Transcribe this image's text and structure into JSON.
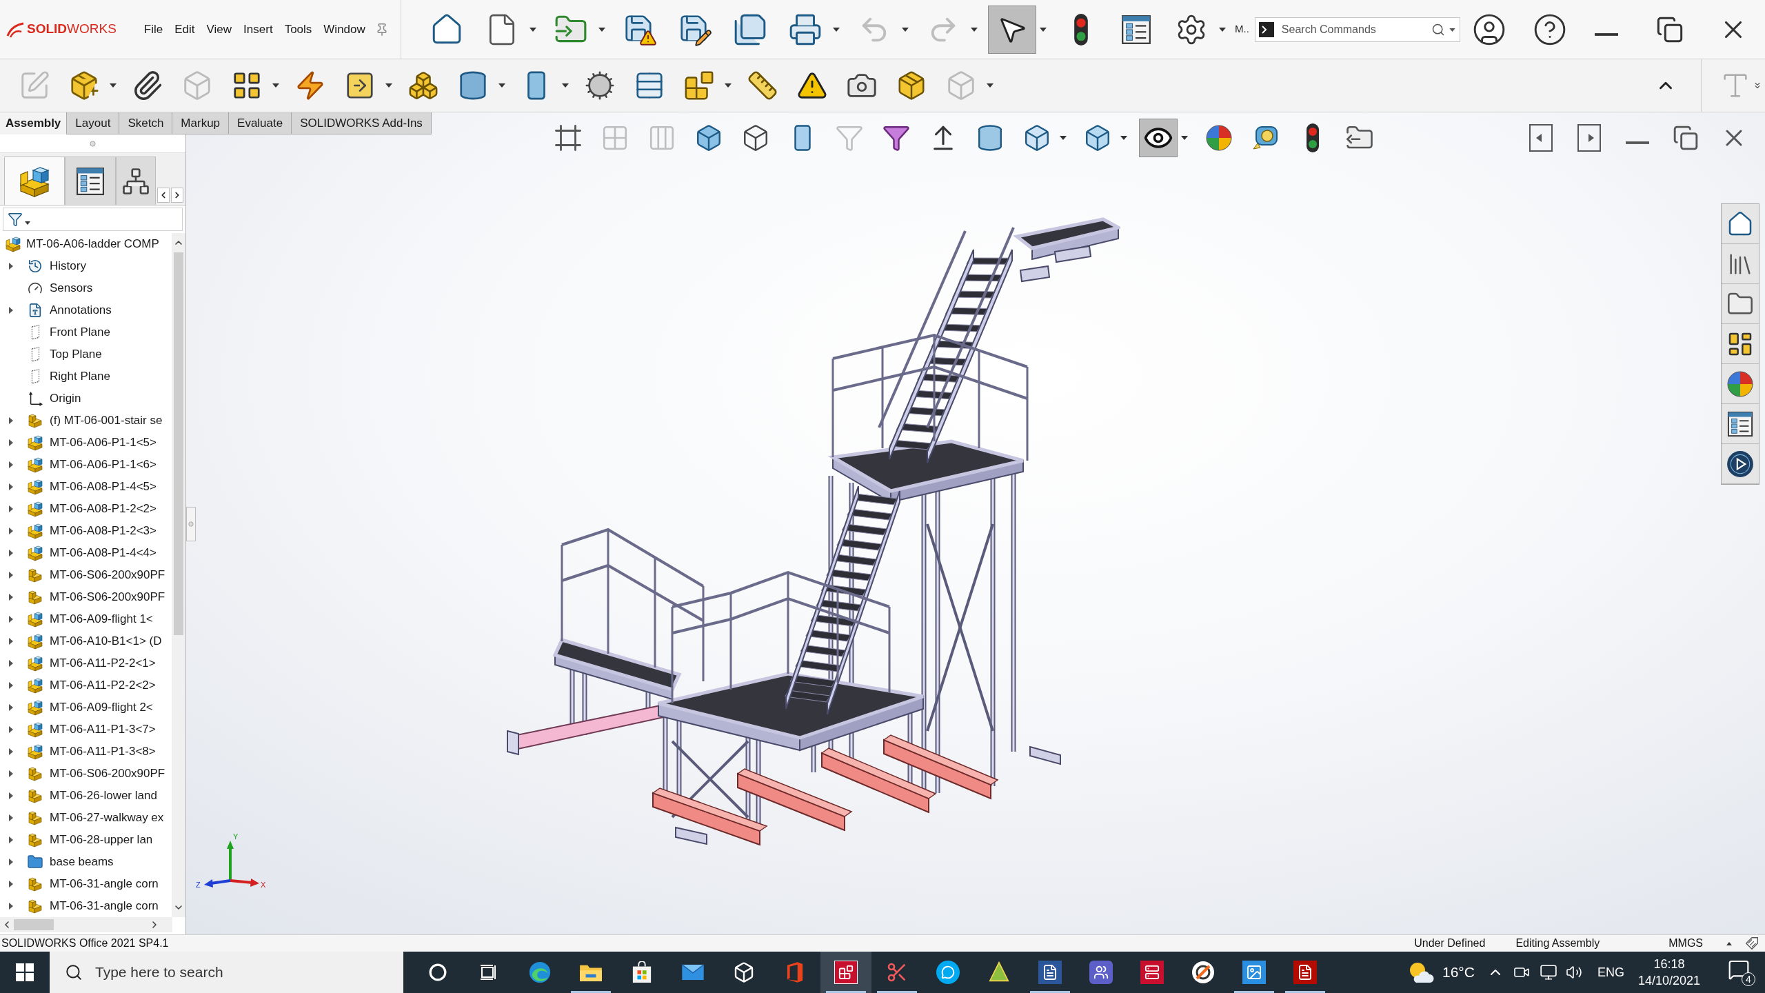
{
  "title_bar": {
    "logo": "**SOLID**WORKS",
    "menus": [
      {
        "label": "File"
      },
      {
        "label": "Edit"
      },
      {
        "label": "View"
      },
      {
        "label": "Insert"
      },
      {
        "label": "Tools"
      },
      {
        "label": "Window"
      }
    ],
    "tools": [
      {
        "kind": "home",
        "dropdown": false,
        "disabled": false,
        "active": false
      },
      {
        "kind": "new",
        "dropdown": true,
        "disabled": false,
        "active": false
      },
      {
        "kind": "open",
        "dropdown": true,
        "disabled": false,
        "active": false
      },
      {
        "kind": "save",
        "dropdown": false,
        "disabled": false,
        "active": false
      },
      {
        "kind": "save_as",
        "dropdown": false,
        "disabled": false,
        "active": false
      },
      {
        "kind": "save_all",
        "dropdown": false,
        "disabled": false,
        "active": false
      },
      {
        "kind": "print",
        "dropdown": true,
        "disabled": false,
        "active": false
      },
      {
        "kind": "undo",
        "dropdown": true,
        "disabled": true,
        "active": false
      },
      {
        "kind": "redo",
        "dropdown": true,
        "disabled": true,
        "active": false
      },
      {
        "kind": "select",
        "dropdown": true,
        "disabled": false,
        "active": true
      },
      {
        "kind": "rebuild",
        "dropdown": false,
        "disabled": false,
        "active": false
      },
      {
        "kind": "properties",
        "dropdown": false,
        "disabled": false,
        "active": false
      },
      {
        "kind": "options",
        "dropdown": true,
        "disabled": false,
        "active": false
      }
    ],
    "more": "M..",
    "search": {
      "placeholder": "Search Commands"
    }
  },
  "command_manager": {
    "tools": [
      {
        "kind": "edit_component",
        "dropdown": false,
        "disabled": true
      },
      {
        "kind": "insert_components",
        "dropdown": true,
        "disabled": false
      },
      {
        "kind": "mate",
        "dropdown": false,
        "disabled": false
      },
      {
        "kind": "preview",
        "dropdown": false,
        "disabled": true
      },
      {
        "kind": "pattern",
        "dropdown": true,
        "disabled": false
      },
      {
        "kind": "fasteners",
        "dropdown": false,
        "disabled": false
      },
      {
        "kind": "move",
        "dropdown": true,
        "disabled": false
      },
      {
        "kind": "show_hidden",
        "dropdown": false,
        "disabled": false
      },
      {
        "kind": "features",
        "dropdown": true,
        "disabled": false
      },
      {
        "kind": "reference",
        "dropdown": true,
        "disabled": false
      },
      {
        "kind": "motion",
        "dropdown": false,
        "disabled": false
      },
      {
        "kind": "bom",
        "dropdown": false,
        "disabled": false
      },
      {
        "kind": "explode",
        "dropdown": true,
        "disabled": false
      },
      {
        "kind": "measure",
        "dropdown": false,
        "disabled": false
      },
      {
        "kind": "interference",
        "dropdown": false,
        "disabled": false
      },
      {
        "kind": "snapshot",
        "dropdown": false,
        "disabled": false
      },
      {
        "kind": "review",
        "dropdown": false,
        "disabled": false
      },
      {
        "kind": "speedpak",
        "dropdown": true,
        "disabled": true
      }
    ]
  },
  "tabs": [
    {
      "label": "Assembly",
      "selected": true
    },
    {
      "label": "Layout",
      "selected": false
    },
    {
      "label": "Sketch",
      "selected": false
    },
    {
      "label": "Markup",
      "selected": false
    },
    {
      "label": "Evaluate",
      "selected": false
    },
    {
      "label": "SOLIDWORKS Add-Ins",
      "selected": false
    }
  ],
  "view_toolbar": [
    {
      "kind": "zoom_fit",
      "dropdown": false,
      "disabled": false,
      "active": false
    },
    {
      "kind": "zoom_area",
      "dropdown": false,
      "disabled": true,
      "active": false
    },
    {
      "kind": "previous",
      "dropdown": false,
      "disabled": true,
      "active": false
    },
    {
      "kind": "section",
      "dropdown": false,
      "disabled": false,
      "active": false
    },
    {
      "kind": "wireframe",
      "dropdown": false,
      "disabled": false,
      "active": false
    },
    {
      "kind": "plane",
      "dropdown": false,
      "disabled": false,
      "active": false
    },
    {
      "kind": "filter_off",
      "dropdown": false,
      "disabled": true,
      "active": false
    },
    {
      "kind": "filter",
      "dropdown": false,
      "disabled": false,
      "active": false
    },
    {
      "kind": "normal",
      "dropdown": false,
      "disabled": false,
      "active": false
    },
    {
      "kind": "cylinder",
      "dropdown": false,
      "disabled": false,
      "active": false
    },
    {
      "kind": "orientation",
      "dropdown": true,
      "disabled": false,
      "active": false
    },
    {
      "kind": "display",
      "dropdown": true,
      "disabled": false,
      "active": false
    },
    {
      "kind": "hide_show",
      "dropdown": true,
      "disabled": false,
      "active": true
    },
    {
      "kind": "appearance",
      "dropdown": false,
      "disabled": false,
      "active": false
    },
    {
      "kind": "scene",
      "dropdown": false,
      "disabled": false,
      "active": false
    },
    {
      "kind": "rebuild",
      "dropdown": false,
      "disabled": false,
      "active": false
    },
    {
      "kind": "folder",
      "dropdown": false,
      "disabled": false,
      "active": false
    }
  ],
  "feature_manager": {
    "tabs": [
      {
        "kind": "tree",
        "selected": true
      },
      {
        "kind": "properties",
        "selected": false
      },
      {
        "kind": "configurations",
        "selected": false
      }
    ],
    "tree": {
      "label": "MT-06-A06-ladder COMP",
      "kind": "assembly",
      "children": [
        {
          "label": "History",
          "kind": "history",
          "expandable": true
        },
        {
          "label": "Sensors",
          "kind": "sensors",
          "expandable": false
        },
        {
          "label": "Annotations",
          "kind": "annotations",
          "expandable": true
        },
        {
          "label": "Front Plane",
          "kind": "plane",
          "expandable": false
        },
        {
          "label": "Top Plane",
          "kind": "plane",
          "expandable": false
        },
        {
          "label": "Right Plane",
          "kind": "plane",
          "expandable": false
        },
        {
          "label": "Origin",
          "kind": "origin",
          "expandable": false
        },
        {
          "label": "(f) MT-06-001-stair se",
          "kind": "part",
          "expandable": true
        },
        {
          "label": "MT-06-A06-P1-1<5>",
          "kind": "assembly",
          "expandable": true
        },
        {
          "label": "MT-06-A06-P1-1<6>",
          "kind": "assembly",
          "expandable": true
        },
        {
          "label": "MT-06-A08-P1-4<5>",
          "kind": "assembly",
          "expandable": true
        },
        {
          "label": "MT-06-A08-P1-2<2>",
          "kind": "assembly",
          "expandable": true
        },
        {
          "label": "MT-06-A08-P1-2<3>",
          "kind": "assembly",
          "expandable": true
        },
        {
          "label": "MT-06-A08-P1-4<4>",
          "kind": "assembly",
          "expandable": true
        },
        {
          "label": "MT-06-S06-200x90PF",
          "kind": "part",
          "expandable": true
        },
        {
          "label": "MT-06-S06-200x90PF",
          "kind": "part",
          "expandable": true
        },
        {
          "label": "MT-06-A09-flight 1<",
          "kind": "assembly",
          "expandable": true
        },
        {
          "label": "MT-06-A10-B1<1> (D",
          "kind": "assembly",
          "expandable": true
        },
        {
          "label": "MT-06-A11-P2-2<1>",
          "kind": "assembly",
          "expandable": true
        },
        {
          "label": "MT-06-A11-P2-2<2>",
          "kind": "assembly",
          "expandable": true
        },
        {
          "label": "MT-06-A09-flight 2<",
          "kind": "assembly",
          "expandable": true
        },
        {
          "label": "MT-06-A11-P1-3<7>",
          "kind": "assembly",
          "expandable": true
        },
        {
          "label": "MT-06-A11-P1-3<8>",
          "kind": "assembly",
          "expandable": true
        },
        {
          "label": "MT-06-S06-200x90PF",
          "kind": "part",
          "expandable": true
        },
        {
          "label": "MT-06-26-lower land",
          "kind": "part",
          "expandable": true
        },
        {
          "label": "MT-06-27-walkway ex",
          "kind": "part",
          "expandable": true
        },
        {
          "label": "MT-06-28-upper lan",
          "kind": "part",
          "expandable": true
        },
        {
          "label": "base beams",
          "kind": "folder",
          "expandable": true
        },
        {
          "label": "MT-06-31-angle corn",
          "kind": "part",
          "expandable": true
        },
        {
          "label": "MT-06-31-angle corn",
          "kind": "part",
          "expandable": true
        }
      ]
    }
  },
  "viewport": {
    "triad": {
      "x": "X",
      "y": "Y",
      "z": "Z"
    }
  },
  "task_pane": [
    {
      "kind": "home"
    },
    {
      "kind": "library"
    },
    {
      "kind": "explorer"
    },
    {
      "kind": "palette"
    },
    {
      "kind": "appearances"
    },
    {
      "kind": "properties"
    },
    {
      "kind": "vr"
    }
  ],
  "status_bar": {
    "version": "SOLIDWORKS Office 2021 SP4.1",
    "state": "Under Defined",
    "mode": "Editing Assembly",
    "units": "MMGS"
  },
  "taskbar": {
    "search": {
      "placeholder": "Type here to search"
    },
    "apps": [
      {
        "kind": "edge",
        "running": false,
        "selected": false
      },
      {
        "kind": "explorer",
        "running": true,
        "selected": false
      },
      {
        "kind": "store",
        "running": false,
        "selected": false
      },
      {
        "kind": "mail",
        "running": false,
        "selected": false
      },
      {
        "kind": "viewer3d",
        "running": false,
        "selected": false
      },
      {
        "kind": "office",
        "running": false,
        "selected": false
      },
      {
        "kind": "solidworks",
        "running": true,
        "selected": true
      },
      {
        "kind": "snip",
        "running": true,
        "selected": false
      },
      {
        "kind": "skype",
        "running": false,
        "selected": false
      },
      {
        "kind": "draftsight",
        "running": false,
        "selected": false
      },
      {
        "kind": "word",
        "running": true,
        "selected": false
      },
      {
        "kind": "teams",
        "running": false,
        "selected": false
      },
      {
        "kind": "pdm",
        "running": false,
        "selected": false
      },
      {
        "kind": "orange",
        "running": false,
        "selected": false
      },
      {
        "kind": "photos",
        "running": true,
        "selected": false
      },
      {
        "kind": "acrobat",
        "running": true,
        "selected": false
      }
    ],
    "weather": "16°C",
    "language": "ENG",
    "time": "16:18",
    "date": "14/10/2021",
    "notifications": "4"
  }
}
